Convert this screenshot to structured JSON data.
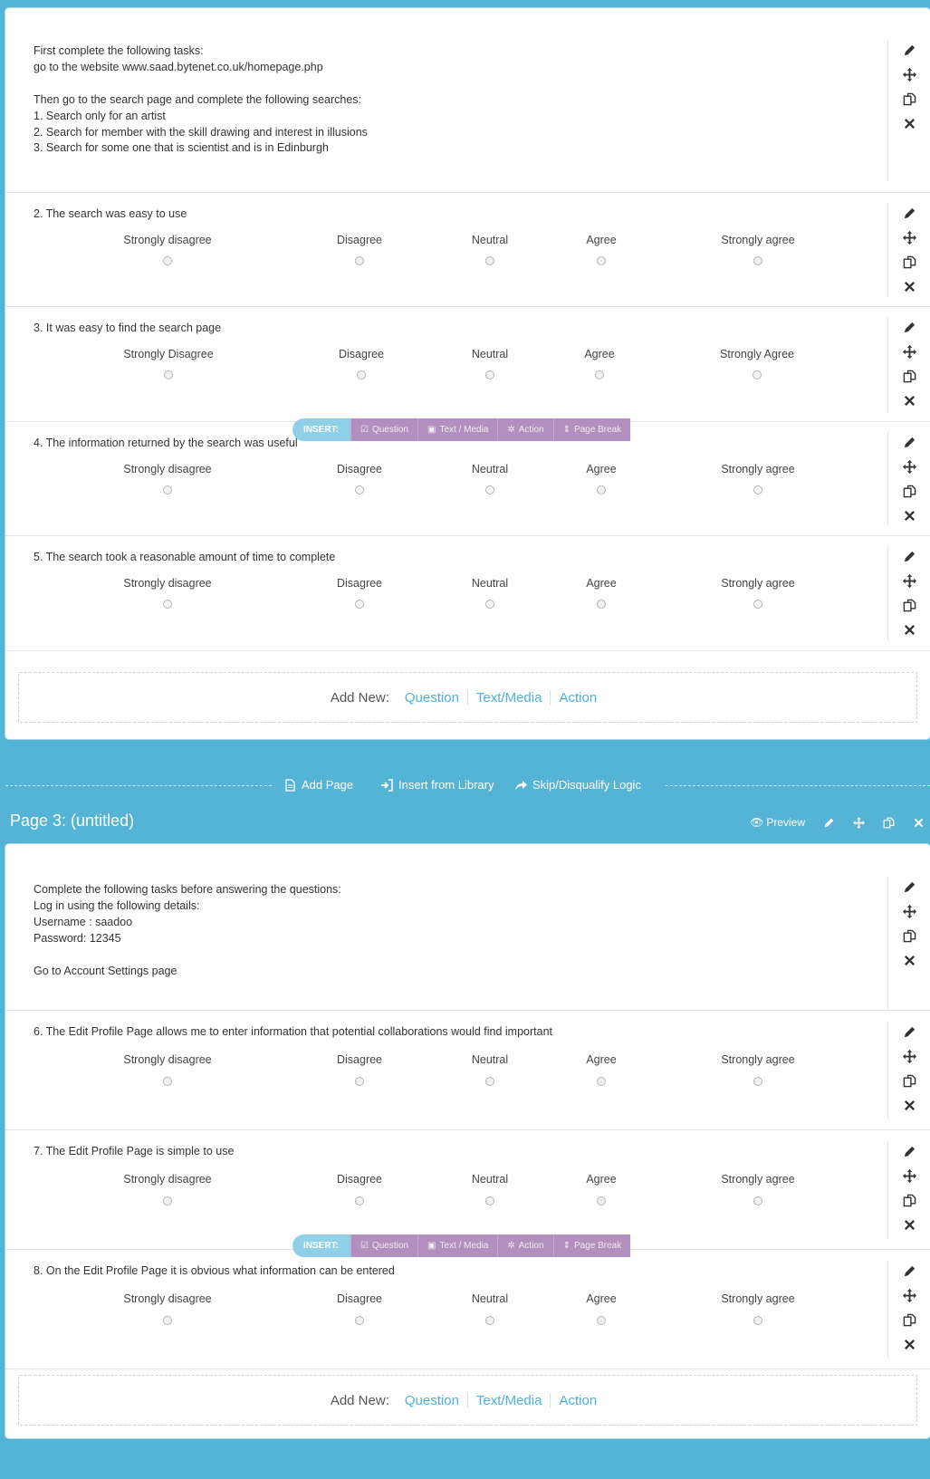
{
  "page2": {
    "intro_lines": [
      "First complete the following tasks:",
      "go to the website www.saad.bytenet.co.uk/homepage.php",
      "",
      "Then go to the search page and complete the following searches:",
      "1. Search only for an artist",
      "2. Search for member with the skill drawing and interest in illusions",
      "3. Search for some one that is scientist and is in Edinburgh"
    ],
    "questions": [
      {
        "title": "2. The search was easy to use",
        "scale": [
          "Strongly disagree",
          "Disagree",
          "Neutral",
          "Agree",
          "Strongly agree"
        ]
      },
      {
        "title": "3. It was easy to find the search page",
        "scale": [
          "Strongly Disagree",
          "Disagree",
          "Neutral",
          "Agree",
          "Strongly Agree"
        ]
      },
      {
        "title": "4. The information returned by the search was useful",
        "scale": [
          "Strongly disagree",
          "Disagree",
          "Neutral",
          "Agree",
          "Strongly agree"
        ]
      },
      {
        "title": "5. The search took a reasonable amount of time to complete",
        "scale": [
          "Strongly disagree",
          "Disagree",
          "Neutral",
          "Agree",
          "Strongly agree"
        ]
      }
    ]
  },
  "insert_bar": {
    "label": "INSERT:",
    "question": "Question",
    "text_media": "Text / Media",
    "action": "Action",
    "page_break": "Page Break"
  },
  "add_new": {
    "label": "Add New:",
    "question": "Question",
    "text_media": "Text/Media",
    "action": "Action"
  },
  "page_separator": {
    "add_page": "Add Page",
    "insert_library": "Insert from Library",
    "skip_logic": "Skip/Disqualify Logic"
  },
  "page3": {
    "title": "Page 3: (untitled)",
    "preview": "Preview",
    "intro_lines": [
      "Complete the following tasks before answering the questions:",
      "Log in using the following details:",
      "Username : saadoo",
      "Password: 12345",
      "",
      "Go to Account Settings page"
    ],
    "questions": [
      {
        "title": "6. The Edit Profile Page allows me to enter information that potential collaborations would find important",
        "scale": [
          "Strongly disagree",
          "Disagree",
          "Neutral",
          "Agree",
          "Strongly agree"
        ]
      },
      {
        "title": "7. The Edit Profile Page is simple to use",
        "scale": [
          "Strongly disagree",
          "Disagree",
          "Neutral",
          "Agree",
          "Strongly agree"
        ]
      },
      {
        "title": "8. On the Edit Profile Page it is obvious what information can be entered",
        "scale": [
          "Strongly disagree",
          "Disagree",
          "Neutral",
          "Agree",
          "Strongly agree"
        ]
      }
    ]
  },
  "colors": {
    "background": "#55b4d6",
    "link": "#4ab3d9",
    "insert_purple": "#b28fbf",
    "insert_blue": "#8fd0e8"
  }
}
